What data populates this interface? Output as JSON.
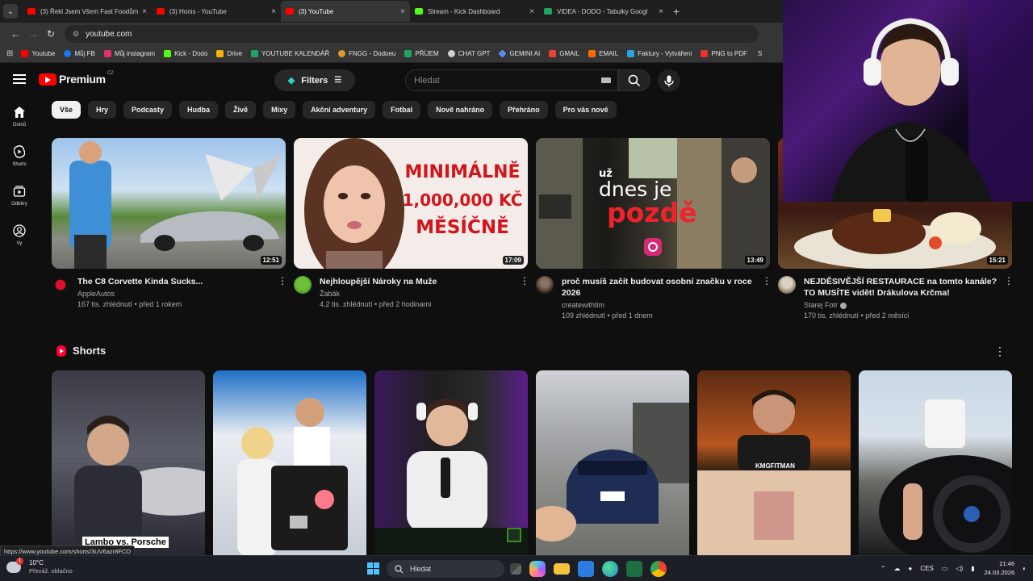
{
  "browser": {
    "tabs": [
      {
        "label": "(3) Řekl Jsem Všem Fast Foodům",
        "fav_color": "#ff0000",
        "active": false
      },
      {
        "label": "(3) Honis - YouTube",
        "fav_color": "#ff0000",
        "active": false
      },
      {
        "label": "(3) YouTube",
        "fav_color": "#ff0000",
        "active": true
      },
      {
        "label": "Stream - Kick Dashboard",
        "fav_color": "#53fc18",
        "active": false
      },
      {
        "label": "VIDEA - DODO - Tabulky Googl",
        "fav_color": "#1fa463",
        "active": false
      }
    ],
    "close_glyph": "×",
    "new_tab_glyph": "+",
    "address": "youtube.com",
    "bookmarks": [
      {
        "label": "Youtube",
        "color": "#ff0000"
      },
      {
        "label": "Můj FB",
        "color": "#1877f2"
      },
      {
        "label": "Můj instagram",
        "color": "#e1306c"
      },
      {
        "label": "Kick - Dodo",
        "color": "#53fc18"
      },
      {
        "label": "Drive",
        "color": "#f4b400"
      },
      {
        "label": "YOUTUBE KALENDÁŘ",
        "color": "#1fa463"
      },
      {
        "label": "FNGG - Dodoeu",
        "color": "#d89b2b"
      },
      {
        "label": "PŘÍJEM",
        "color": "#1fa463"
      },
      {
        "label": "CHAT GPT",
        "color": "#cfcfcf"
      },
      {
        "label": "GEMINI AI",
        "color": "#5b8def"
      },
      {
        "label": "GMAIL",
        "color": "#ea4335"
      },
      {
        "label": "EMAIL",
        "color": "#ff6a00"
      },
      {
        "label": "Faktury - Vytváření",
        "color": "#2aa5e0"
      },
      {
        "label": "PNG to PDF",
        "color": "#e5322d"
      },
      {
        "label": "S",
        "color": "#333333"
      }
    ]
  },
  "youtube": {
    "logo_text": "Premium",
    "logo_region": "CZ",
    "filters_label": "Filters",
    "search_placeholder": "Hledat",
    "sidebar": [
      {
        "label": "Domů",
        "icon": "home-icon"
      },
      {
        "label": "Shorts",
        "icon": "shorts-icon"
      },
      {
        "label": "Odběry",
        "icon": "subscriptions-icon"
      },
      {
        "label": "Vy",
        "icon": "you-icon"
      }
    ],
    "chips": [
      "Vše",
      "Hry",
      "Podcasty",
      "Hudba",
      "Živě",
      "Mixy",
      "Akční adventury",
      "Fotbal",
      "Nově nahráno",
      "Přehráno",
      "Pro vás nové"
    ],
    "videos": [
      {
        "title": "The C8 Corvette Kinda Sucks...",
        "channel": "AppleAutos",
        "stats": "167 tis. zhlédnutí • před 1 rokem",
        "duration": "12:51"
      },
      {
        "title": "Nejhloupější Nároky na Muže",
        "channel": "Žabák",
        "stats": "4,2 tis. zhlédnutí • před 2 hodinami",
        "duration": "17:09",
        "thumb_text": [
          "MINIMÁLNĚ",
          "1,000,000 KČ",
          "MĚSÍČNĚ"
        ]
      },
      {
        "title": "proč musíš začít budovat osobní značku v roce 2026",
        "channel": "createwithtim",
        "stats": "109 zhlédnutí • před 1 dnem",
        "duration": "13:49",
        "thumb_text": [
          "už",
          "dnes je",
          "pozdě"
        ]
      },
      {
        "title": "NEJDĚSIVĚJŠÍ RESTAURACE na tomto kanále? TO MUSÍTE vidět! Drákulova Krčma!",
        "channel": "Starej Fotr",
        "stats": "170 tis. zhlédnutí • před 2 měsíci",
        "duration": "15:21"
      }
    ],
    "shorts_title": "Shorts",
    "shorts": [
      {
        "caption": "Lambo vs. Porsche"
      },
      {
        "caption": ""
      },
      {
        "caption": ""
      },
      {
        "caption": ""
      },
      {
        "caption": "KMGFITMAN"
      },
      {
        "caption": ""
      }
    ]
  },
  "status_url": "https://www.youtube.com/shorts/3UV6azr8FCO",
  "taskbar": {
    "weather_badge": "1",
    "weather_temp": "10°C",
    "weather_desc": "Převáž. oblačno",
    "search_label": "Hledat",
    "lang": "CES",
    "time": "21:46",
    "date": "24.03.2026"
  }
}
